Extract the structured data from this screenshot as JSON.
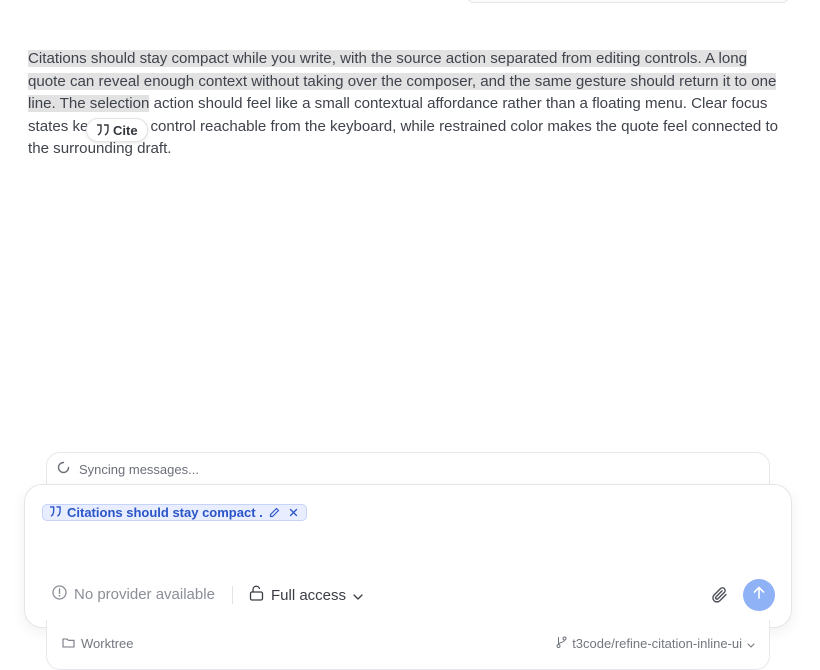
{
  "article": {
    "segments": [
      {
        "text": "Citations should stay compact while you write, with the source action separated from editing controls. A long quote can reveal enough context without taking over the composer, and the same gesture should return it to one line. The selection",
        "highlighted": true
      },
      {
        "text": " action should feel like a small contextual affordance rather than a floating menu. Clear focus states keep every control reachable from the keyboard, while restrained color makes the quote feel connected to the surrounding draft.",
        "highlighted": false
      }
    ]
  },
  "cite_popover": {
    "label": "Cite",
    "icon": "quote-icon"
  },
  "sync": {
    "status": "Syncing messages...",
    "icon": "spinner-icon"
  },
  "composer": {
    "citation_chip": {
      "label": "Citations should stay compact ...",
      "edit_icon": "pencil-icon",
      "remove_icon": "close-icon"
    },
    "provider": {
      "label": "No provider available",
      "icon": "info-icon"
    },
    "access": {
      "label": "Full access",
      "icon": "unlock-icon"
    },
    "attach_icon": "paperclip-icon",
    "send_icon": "arrow-up-icon"
  },
  "footer": {
    "worktree_label": "Worktree",
    "branch_label": "t3code/refine-citation-inline-ui"
  },
  "colors": {
    "accent": "#2a55c9",
    "chip_bg": "#e8edff",
    "send_bg": "#8fb1f6",
    "highlight": "#e2e2e3"
  }
}
